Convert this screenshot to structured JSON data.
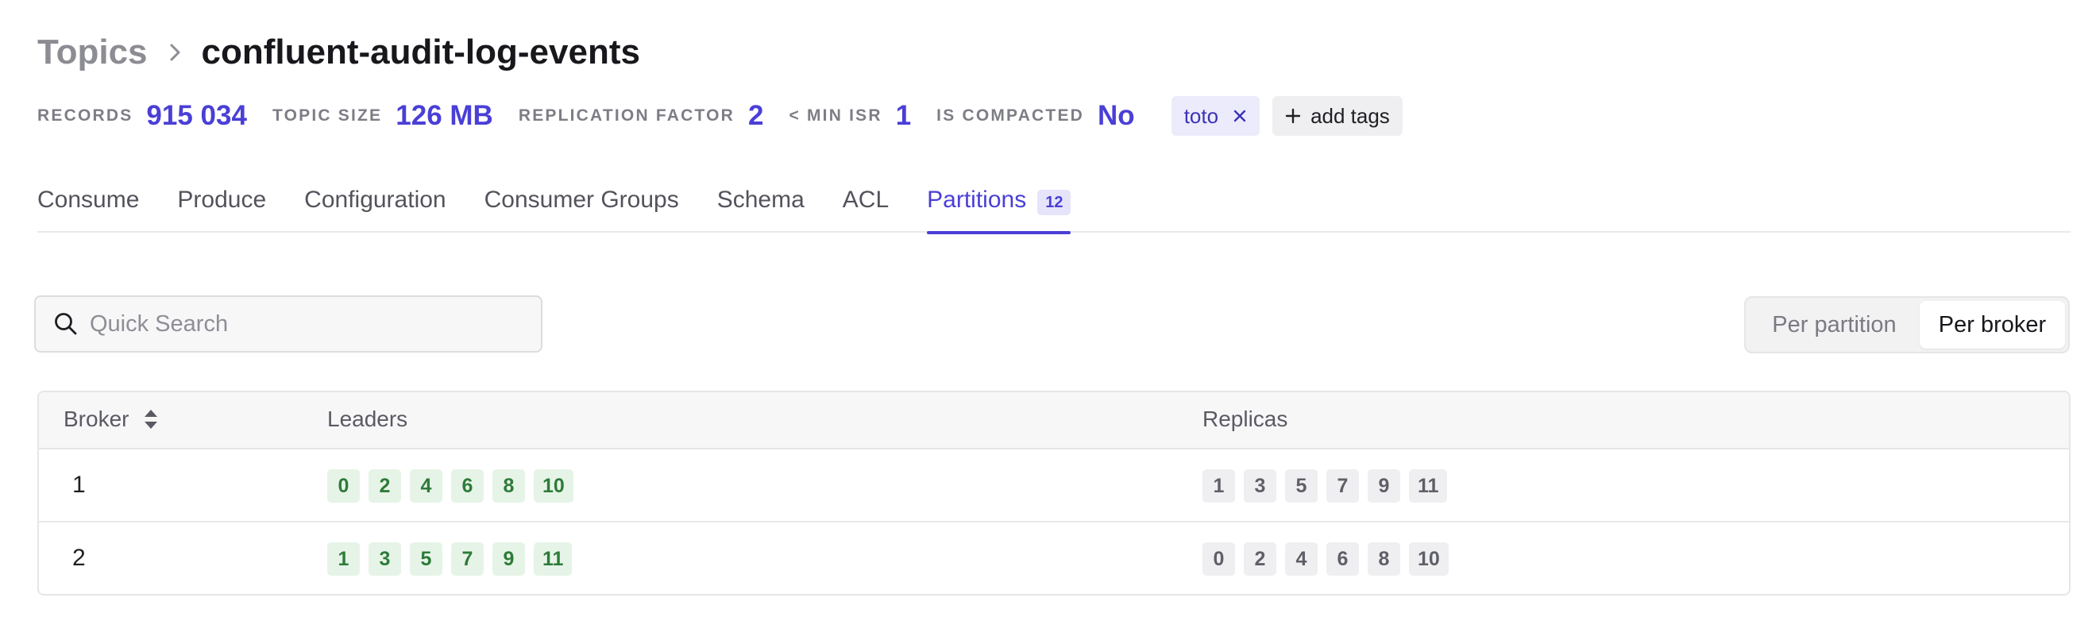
{
  "breadcrumb": {
    "root": "Topics",
    "current": "confluent-audit-log-events",
    "separator_icon": "chevron-right-icon"
  },
  "stats": [
    {
      "label": "RECORDS",
      "value": "915 034"
    },
    {
      "label": "TOPIC SIZE",
      "value": "126 MB"
    },
    {
      "label": "REPLICATION FACTOR",
      "value": "2"
    },
    {
      "label": "< MIN ISR",
      "value": "1"
    },
    {
      "label": "IS COMPACTED",
      "value": "No"
    }
  ],
  "tags": [
    {
      "label": "toto"
    }
  ],
  "add_tags_label": "add tags",
  "tabs": [
    {
      "label": "Consume"
    },
    {
      "label": "Produce"
    },
    {
      "label": "Configuration"
    },
    {
      "label": "Consumer Groups"
    },
    {
      "label": "Schema"
    },
    {
      "label": "ACL"
    },
    {
      "label": "Partitions",
      "badge": "12",
      "active": true
    }
  ],
  "search": {
    "placeholder": "Quick Search",
    "value": ""
  },
  "view_toggle": {
    "options": [
      "Per partition",
      "Per broker"
    ],
    "selected": "Per broker"
  },
  "table": {
    "columns": {
      "broker": "Broker",
      "leaders": "Leaders",
      "replicas": "Replicas"
    },
    "rows": [
      {
        "broker": "1",
        "leaders": [
          "0",
          "2",
          "4",
          "6",
          "8",
          "10"
        ],
        "replicas": [
          "1",
          "3",
          "5",
          "7",
          "9",
          "11"
        ]
      },
      {
        "broker": "2",
        "leaders": [
          "1",
          "3",
          "5",
          "7",
          "9",
          "11"
        ],
        "replicas": [
          "0",
          "2",
          "4",
          "6",
          "8",
          "10"
        ]
      }
    ]
  },
  "colors": {
    "accent": "#4a3fd6",
    "leader_chip_bg": "#e6f4e7",
    "leader_chip_text": "#2e7b39",
    "replica_chip_bg": "#efeff1",
    "replica_chip_text": "#5f5f68"
  }
}
